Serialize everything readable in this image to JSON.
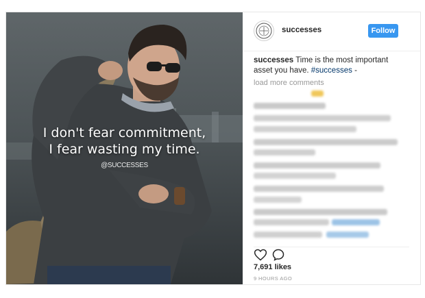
{
  "post": {
    "image": {
      "quote_line1": "I don't fear commitment,",
      "quote_line2": "I fear wasting my time.",
      "watermark": "@SUCCESSES"
    },
    "header": {
      "username": "successes",
      "follow_label": "Follow"
    },
    "caption": {
      "username": "successes",
      "text": "Time is the most important asset you have.",
      "hashtag": "#successes",
      "suffix": "-"
    },
    "load_more": "load more comments",
    "comments_blurred": true,
    "actions": {
      "icons": [
        "heart-icon",
        "comment-icon"
      ]
    },
    "likes": "7,691 likes",
    "timestamp": "9 HOURS AGO",
    "colors": {
      "follow_button": "#3897f0",
      "hashtag": "#003569",
      "muted_text": "#999999",
      "primary_text": "#262626"
    }
  }
}
